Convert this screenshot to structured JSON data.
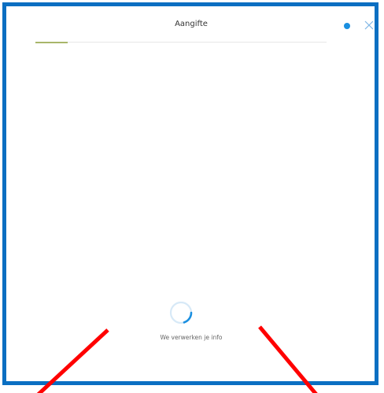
{
  "dialog": {
    "title": "Aangifte",
    "status_dot_color": "#1a8fe0",
    "close_icon": "close-icon"
  },
  "progress": {
    "fraction": 0.11,
    "color": "#a8b66a"
  },
  "loading": {
    "message": "We verwerken je info",
    "spinner_color": "#1a8fe0"
  },
  "annotation": {
    "color": "#ff0000"
  }
}
